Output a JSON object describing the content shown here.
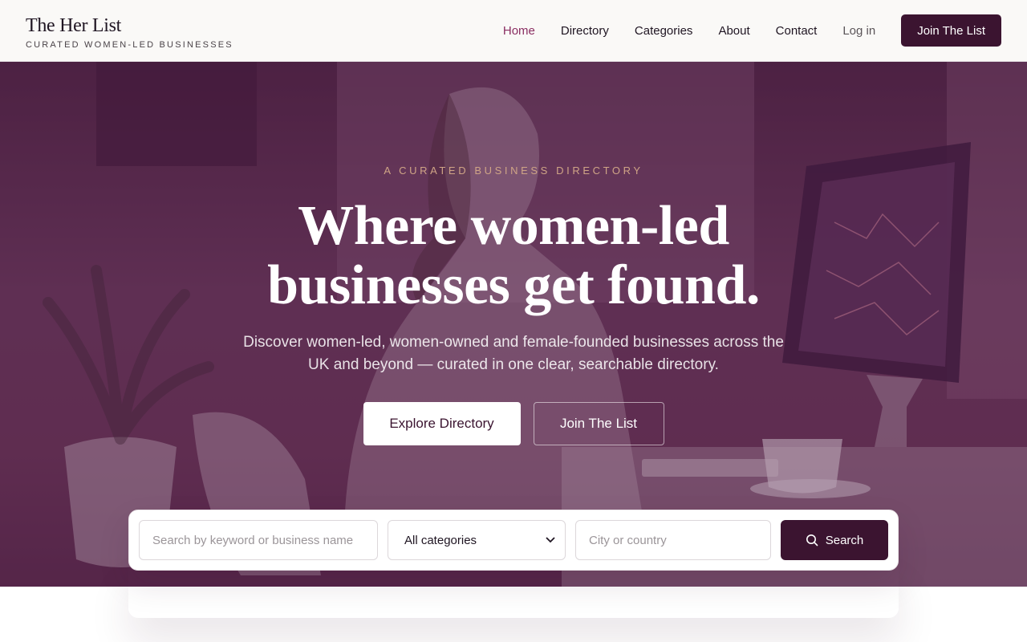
{
  "brand": {
    "name": "The Her List",
    "tagline": "CURATED WOMEN-LED BUSINESSES"
  },
  "nav": {
    "items": [
      {
        "label": "Home",
        "active": true
      },
      {
        "label": "Directory"
      },
      {
        "label": "Categories"
      },
      {
        "label": "About"
      },
      {
        "label": "Contact"
      }
    ],
    "login": "Log in",
    "join": "Join The List"
  },
  "hero": {
    "eyebrow": "A CURATED BUSINESS DIRECTORY",
    "headline_line1": "Where women-led",
    "headline_line2": "businesses get found.",
    "subtext": "Discover women-led, women-owned and female-founded businesses across the UK and beyond — curated in one clear, searchable directory.",
    "cta_primary": "Explore Directory",
    "cta_secondary": "Join The List"
  },
  "search": {
    "keyword_placeholder": "Search by keyword or business name",
    "category_selected": "All categories",
    "city_placeholder": "City or country",
    "button_label": "Search"
  },
  "colors": {
    "accent": "#3b1430",
    "nav_active": "#8a2e62",
    "eyebrow": "#cfa486"
  }
}
